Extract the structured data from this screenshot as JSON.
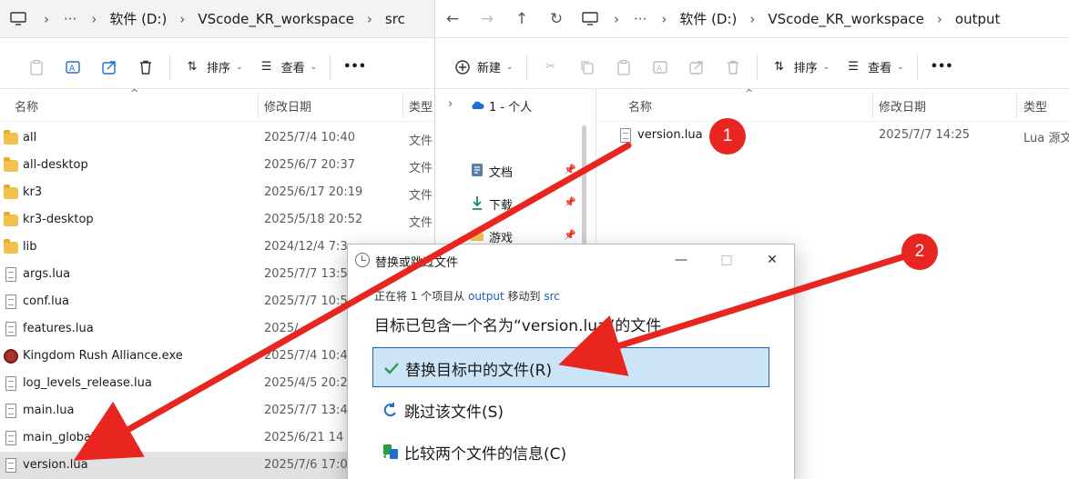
{
  "left_window": {
    "breadcrumb": [
      "软件 (D:)",
      "VScode_KR_workspace",
      "src"
    ],
    "toolbar": {
      "sort_label": "排序",
      "view_label": "查看",
      "more_label": "•••"
    },
    "columns": {
      "name": "名称",
      "date": "修改日期",
      "type": "类型"
    },
    "files": [
      {
        "name": "all",
        "date": "2025/7/4 10:40",
        "type": "文件",
        "icon": "folder"
      },
      {
        "name": "all-desktop",
        "date": "2025/6/7 20:37",
        "type": "文件",
        "icon": "folder"
      },
      {
        "name": "kr3",
        "date": "2025/6/17 20:19",
        "type": "文件",
        "icon": "folder"
      },
      {
        "name": "kr3-desktop",
        "date": "2025/5/18 20:52",
        "type": "文件",
        "icon": "folder"
      },
      {
        "name": "lib",
        "date": "2024/12/4 7:3",
        "type": "文件",
        "icon": "folder"
      },
      {
        "name": "args.lua",
        "date": "2025/7/7 13:5",
        "type": "",
        "icon": "doc"
      },
      {
        "name": "conf.lua",
        "date": "2025/7/7 10:5",
        "type": "",
        "icon": "doc"
      },
      {
        "name": "features.lua",
        "date": "2025/",
        "type": "",
        "icon": "doc"
      },
      {
        "name": "Kingdom Rush Alliance.exe",
        "date": "2025/7/4 10:4",
        "type": "",
        "icon": "exe"
      },
      {
        "name": "log_levels_release.lua",
        "date": "2025/4/5 20:2",
        "type": "",
        "icon": "doc"
      },
      {
        "name": "main.lua",
        "date": "2025/7/7 13:4",
        "type": "",
        "icon": "doc"
      },
      {
        "name": "main_globals.l",
        "date": "2025/6/21 14",
        "type": "",
        "icon": "doc"
      },
      {
        "name": "version.lua",
        "date": "2025/7/6 17:0",
        "type": "",
        "icon": "doc"
      }
    ]
  },
  "right_window": {
    "breadcrumb": [
      "软件 (D:)",
      "VScode_KR_workspace",
      "output"
    ],
    "toolbar": {
      "new_label": "新建",
      "sort_label": "排序",
      "view_label": "查看",
      "more_label": "•••"
    },
    "nav": [
      {
        "label": "1 - 个人",
        "icon": "cloud-icon"
      },
      {
        "label": "文档",
        "icon": "documents-icon"
      },
      {
        "label": "下载",
        "icon": "download-icon"
      },
      {
        "label": "游戏",
        "icon": "folder-icon"
      }
    ],
    "columns": {
      "name": "名称",
      "date": "修改日期",
      "type": "类型"
    },
    "files": [
      {
        "name": "version.lua",
        "date": "2025/7/7 14:25",
        "type": "Lua 源文"
      }
    ]
  },
  "dialog": {
    "title": "替换或跳过文件",
    "sub_prefix": "正在将 1 个项目从",
    "sub_from": "output",
    "sub_middle": "移动到",
    "sub_to": "src",
    "heading": "目标已包含一个名为“version.lua”的文件",
    "options": [
      {
        "label": "替换目标中的文件(R)",
        "icon": "check-icon"
      },
      {
        "label": "跳过该文件(S)",
        "icon": "skip-icon"
      },
      {
        "label": "比较两个文件的信息(C)",
        "icon": "compare-icon"
      }
    ],
    "controls": {
      "minimize": "—",
      "maximize": "□",
      "close": "✕"
    }
  },
  "annotations": [
    {
      "label": "1",
      "color": "#e8251f"
    },
    {
      "label": "2",
      "color": "#e8251f"
    }
  ]
}
